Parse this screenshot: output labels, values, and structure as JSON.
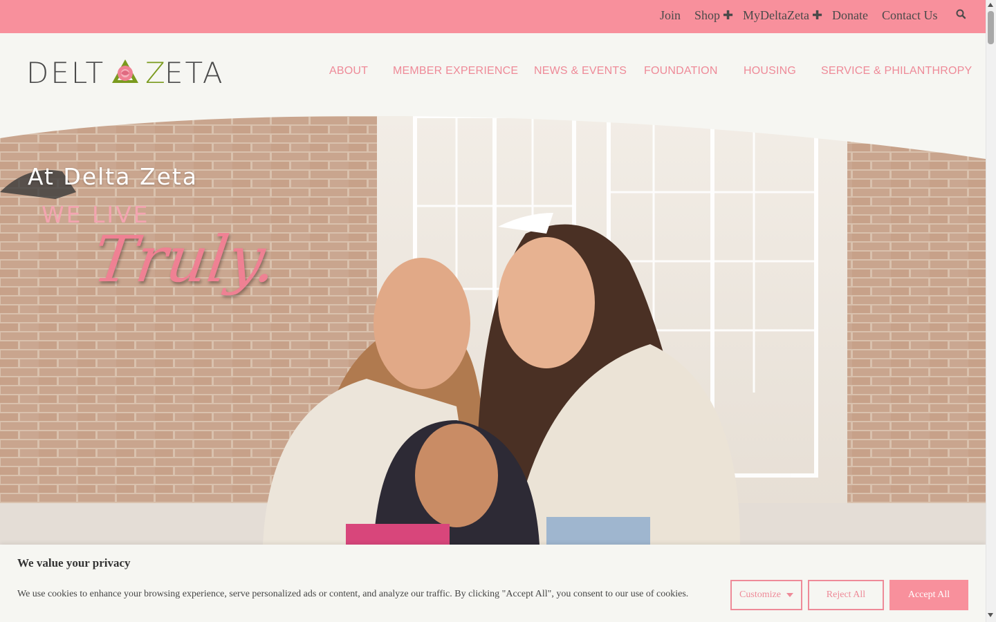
{
  "colors": {
    "topbar": "#f8909c",
    "accent_pink": "#ee8a98",
    "logo_gray": "#4a4a4a",
    "logo_green": "#7a9a1e",
    "page_bg": "#f6f6f2"
  },
  "utility_nav": {
    "join": "Join",
    "shop": "Shop",
    "mydeltazeta": "MyDeltaZeta",
    "donate": "Donate",
    "contact": "Contact Us",
    "plus_icon": "plus-icon",
    "search_icon": "search-icon"
  },
  "logo": {
    "text_left": "DELT",
    "text_right": "ETA",
    "letter_z": "Z",
    "emblem": "rose-triangle-icon"
  },
  "main_nav": {
    "about": "ABOUT",
    "member_experience": "MEMBER EXPERIENCE",
    "news_events": "NEWS & EVENTS",
    "foundation": "FOUNDATION",
    "housing": "HOUSING",
    "service_philanthropy": "SERVICE & PHILANTHROPY"
  },
  "hero": {
    "line1": "At Delta Zeta",
    "line2": "WE LIVE",
    "line3": "Truly."
  },
  "cookie_banner": {
    "title": "We value your privacy",
    "text": "We use cookies to enhance your browsing experience, serve personalized ads or content, and analyze our traffic. By clicking \"Accept All\", you consent to our use of cookies.",
    "customize": "Customize",
    "reject_all": "Reject All",
    "accept_all": "Accept All"
  }
}
